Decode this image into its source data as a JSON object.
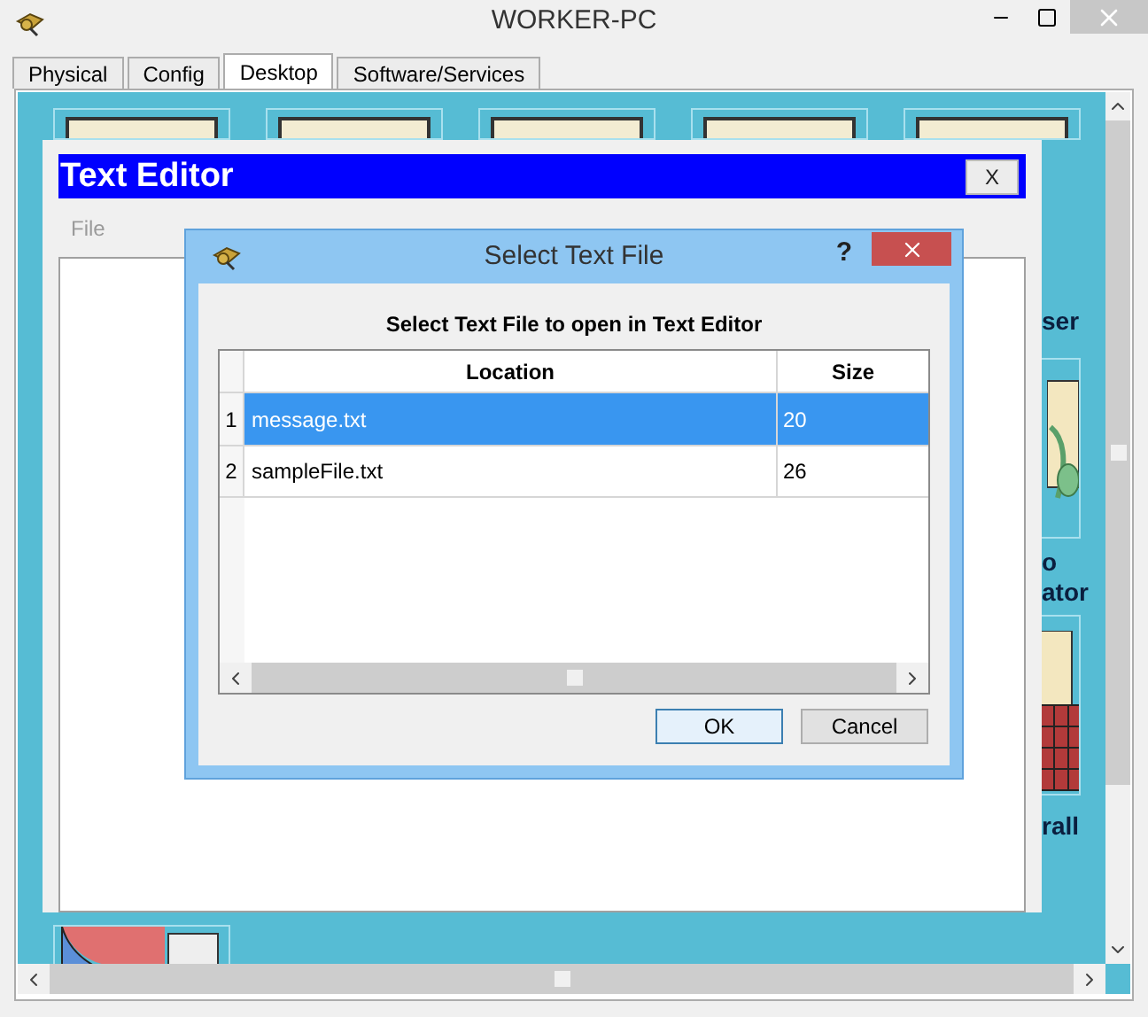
{
  "window": {
    "title": "WORKER-PC"
  },
  "tabs": [
    {
      "label": "Physical",
      "selected": false
    },
    {
      "label": "Config",
      "selected": false
    },
    {
      "label": "Desktop",
      "selected": true
    },
    {
      "label": "Software/Services",
      "selected": false
    }
  ],
  "desktop_labels": [
    "ser",
    "o",
    "ator",
    "rall"
  ],
  "text_editor": {
    "title": "Text Editor",
    "close": "X",
    "menu": [
      {
        "label": "File",
        "disabled": true
      }
    ]
  },
  "dialog": {
    "title": "Select Text File",
    "help": "?",
    "heading": "Select Text File to open in Text Editor",
    "columns": [
      "Location",
      "Size"
    ],
    "rows": [
      {
        "number": "1",
        "location": "message.txt",
        "size": "20",
        "selected": true
      },
      {
        "number": "2",
        "location": "sampleFile.txt",
        "size": "26",
        "selected": false
      }
    ],
    "buttons": [
      {
        "label": "OK",
        "default": true
      },
      {
        "label": "Cancel",
        "default": false
      }
    ]
  }
}
